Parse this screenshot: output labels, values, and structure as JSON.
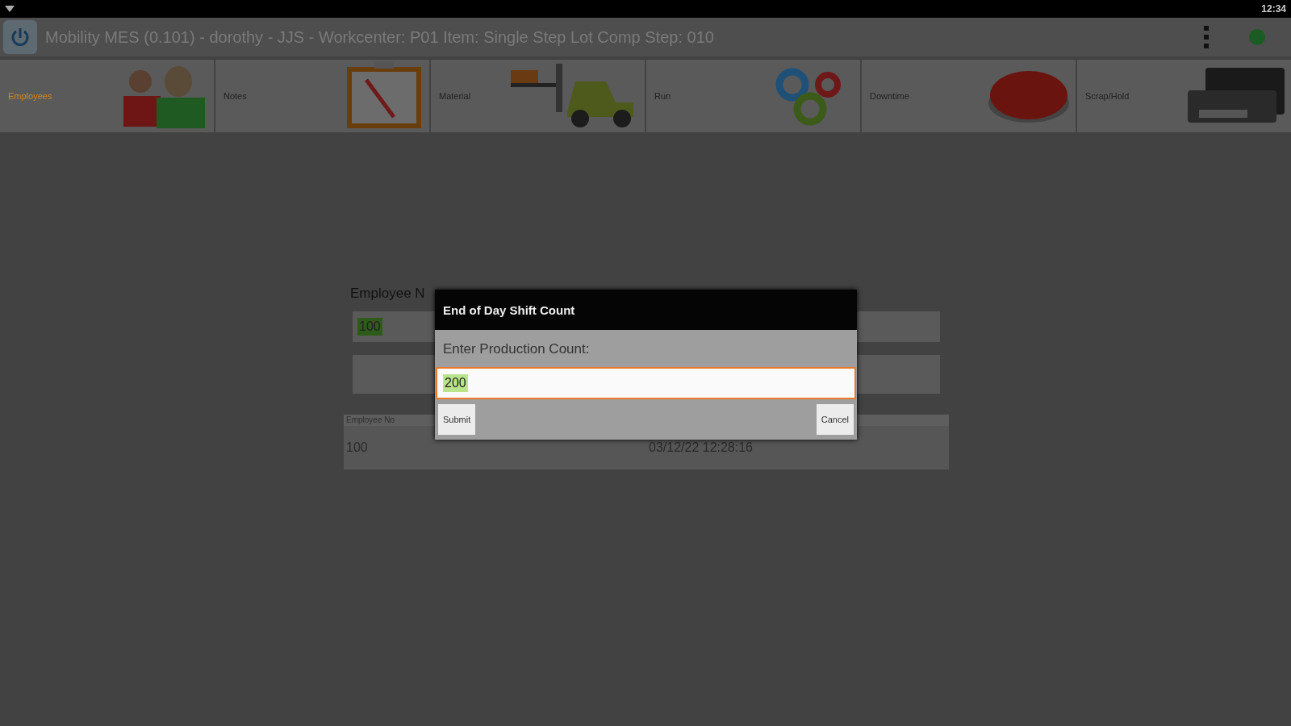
{
  "status_bar": {
    "time": "12:34"
  },
  "app_bar": {
    "title": "Mobility MES (0.101) - dorothy - JJS - Workcenter: P01 Item: Single Step Lot Comp Step: 010"
  },
  "tiles": [
    {
      "label": "Employees",
      "selected": true,
      "kind": "people"
    },
    {
      "label": "Notes",
      "selected": false,
      "kind": "clipboard"
    },
    {
      "label": "Material",
      "selected": false,
      "kind": "forklift"
    },
    {
      "label": "Run",
      "selected": false,
      "kind": "gears"
    },
    {
      "label": "Downtime",
      "selected": false,
      "kind": "stop"
    },
    {
      "label": "Scrap/Hold",
      "selected": false,
      "kind": "printer"
    }
  ],
  "form": {
    "label": "Employee N",
    "value": "100"
  },
  "table": {
    "columns": [
      "Employee No"
    ],
    "rows": [
      [
        "100",
        "03/12/22 12:28:16"
      ]
    ]
  },
  "dialog": {
    "title": "End of Day Shift Count",
    "prompt": "Enter Production Count:",
    "value": "200",
    "buttons": [
      "Submit",
      "Cancel"
    ]
  }
}
